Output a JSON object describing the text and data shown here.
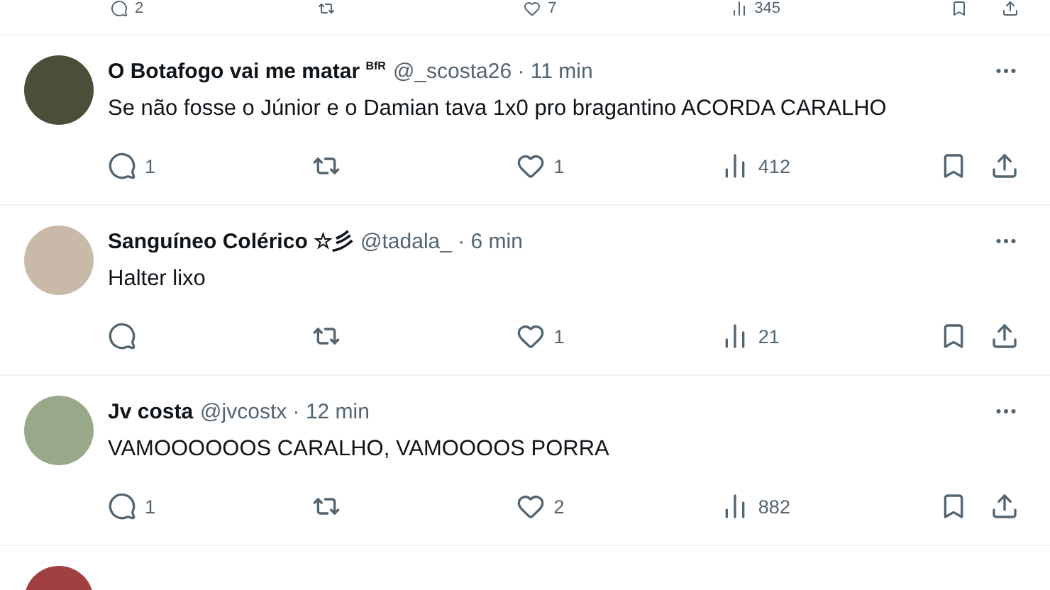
{
  "top_actions": {
    "replies": "2",
    "likes": "7",
    "views": "345"
  },
  "tweets": [
    {
      "name": "O Botafogo vai me matar $^{BfR}$",
      "meta": "@_scosta26 · 11 min",
      "text": "Se não fosse o Júnior e o Damian tava 1x0 pro bragantino ACORDA CARALHO",
      "replies": "1",
      "likes": "1",
      "views": "412"
    },
    {
      "name": "Sanguíneo Colérico ☆彡",
      "meta": "@tadala_ · 6 min",
      "text": "Halter lixo",
      "likes": "1",
      "views": "21"
    },
    {
      "name": "Jv costa",
      "meta": "@jvcostx · 12 min",
      "text": "VAMOOOOOOS CARALHO, VAMOOOOS PORRA",
      "replies": "1",
      "likes": "2",
      "views": "882"
    }
  ]
}
